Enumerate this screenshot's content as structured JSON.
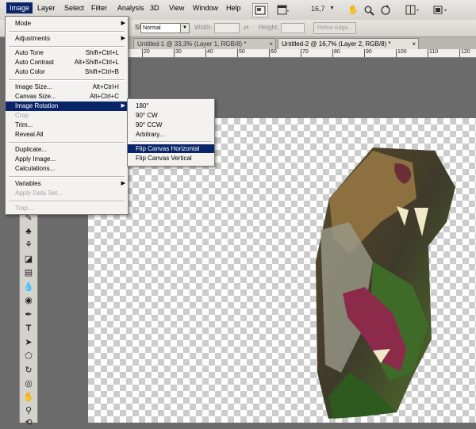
{
  "menubar": {
    "items": [
      "Image",
      "Layer",
      "Select",
      "Filter",
      "Analysis",
      "3D",
      "View",
      "Window",
      "Help"
    ],
    "zoom": "16,7",
    "icons": [
      "ps-layers-icon",
      "screen-mode-icon",
      "zoom-dropdown",
      "hand-icon",
      "zoom-icon",
      "rotate-view-icon",
      "arrange-icon",
      "screen-mode-dropdown-icon"
    ]
  },
  "options": {
    "style_label": "Style:",
    "style_value": "Normal",
    "width_label": "Width:",
    "height_label": "Height:",
    "refine_label": "Refine Edge..."
  },
  "tabs": [
    {
      "label": "Untitled-1 @ 33,3% (Layer 1, RGB/8) *",
      "close": "×"
    },
    {
      "label": "Untitled-2 @ 16,7% (Layer 2, RGB/8) *",
      "close": "×"
    }
  ],
  "ruler": {
    "labels": [
      "20",
      "30",
      "40",
      "50",
      "60",
      "70",
      "80",
      "90",
      "100",
      "110",
      "120"
    ]
  },
  "image_menu": {
    "items": [
      {
        "label": "Mode",
        "shortcut": "",
        "submenu": true,
        "disabled": false
      },
      {
        "label": "Adjustments",
        "shortcut": "",
        "submenu": true,
        "disabled": false
      },
      {
        "label": "Auto Tone",
        "shortcut": "Shift+Ctrl+L",
        "submenu": false,
        "disabled": false
      },
      {
        "label": "Auto Contrast",
        "shortcut": "Alt+Shift+Ctrl+L",
        "submenu": false,
        "disabled": false
      },
      {
        "label": "Auto Color",
        "shortcut": "Shift+Ctrl+B",
        "submenu": false,
        "disabled": false
      },
      {
        "label": "Image Size...",
        "shortcut": "Alt+Ctrl+I",
        "submenu": false,
        "disabled": false
      },
      {
        "label": "Canvas Size...",
        "shortcut": "Alt+Ctrl+C",
        "submenu": false,
        "disabled": false
      },
      {
        "label": "Image Rotation",
        "shortcut": "",
        "submenu": true,
        "disabled": false
      },
      {
        "label": "Crop",
        "shortcut": "",
        "submenu": false,
        "disabled": true
      },
      {
        "label": "Trim...",
        "shortcut": "",
        "submenu": false,
        "disabled": false
      },
      {
        "label": "Reveal All",
        "shortcut": "",
        "submenu": false,
        "disabled": false
      },
      {
        "label": "Duplicate...",
        "shortcut": "",
        "submenu": false,
        "disabled": false
      },
      {
        "label": "Apply Image...",
        "shortcut": "",
        "submenu": false,
        "disabled": false
      },
      {
        "label": "Calculations...",
        "shortcut": "",
        "submenu": false,
        "disabled": false
      },
      {
        "label": "Variables",
        "shortcut": "",
        "submenu": true,
        "disabled": false
      },
      {
        "label": "Apply Data Set...",
        "shortcut": "",
        "submenu": false,
        "disabled": true
      },
      {
        "label": "Trap...",
        "shortcut": "",
        "submenu": false,
        "disabled": true
      }
    ]
  },
  "rotation_submenu": {
    "items": [
      "180°",
      "90° CW",
      "90° CCW",
      "Arbitrary...",
      "Flip Canvas Horizontal",
      "Flip Canvas Vertical"
    ]
  },
  "tools": [
    "brush-icon",
    "stamp-icon",
    "history-brush-icon",
    "eraser-icon",
    "gradient-icon",
    "blur-icon",
    "dodge-icon",
    "pen-icon",
    "type-icon",
    "path-select-icon",
    "shape-icon",
    "3d-rotate-icon",
    "3d-orbit-icon",
    "hand-tool-icon",
    "zoom-tool-icon",
    "rotate-tool-icon"
  ],
  "colors": {
    "highlight": "#0a246a",
    "menu_bg": "#f3f2ef"
  }
}
